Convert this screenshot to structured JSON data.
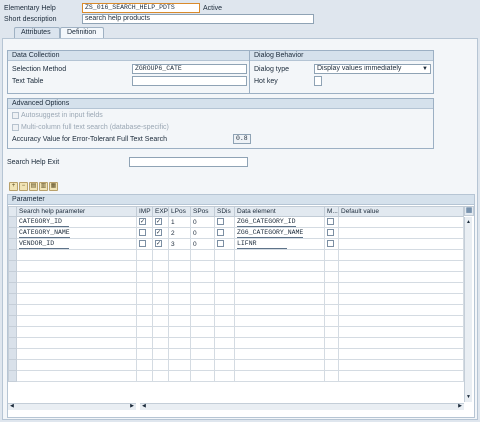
{
  "header": {
    "elementary_help_label": "Elementary Help",
    "elementary_help_value": "ZS_016_SEARCH_HELP_PDTS",
    "status": "Active",
    "short_description_label": "Short description",
    "short_description_value": "search help products"
  },
  "tabs": [
    {
      "label": "Attributes",
      "active": false
    },
    {
      "label": "Definition",
      "active": true
    }
  ],
  "data_collection": {
    "title": "Data Collection",
    "selection_method_label": "Selection Method",
    "selection_method_value": "ZGROUP6_CATE",
    "text_table_label": "Text Table",
    "text_table_value": ""
  },
  "dialog_behavior": {
    "title": "Dialog Behavior",
    "dialog_type_label": "Dialog type",
    "dialog_type_value": "Display values immediately",
    "hot_key_label": "Hot key",
    "hot_key_value": ""
  },
  "advanced_options": {
    "title": "Advanced Options",
    "autosuggest_label": "Autosuggest in input fields",
    "multicolumn_label": "Multi-column full text search (database-specific)",
    "accuracy_label": "Accuracy Value for Error-Tolerant Full Text Search",
    "accuracy_value": "0.8"
  },
  "search_help_exit": {
    "label": "Search Help Exit",
    "value": ""
  },
  "parameter_table": {
    "title": "Parameter",
    "columns": [
      "Search help parameter",
      "IMP",
      "EXP",
      "LPos",
      "SPos",
      "SDis",
      "Data element",
      "M...",
      "Default value"
    ],
    "rows": [
      {
        "param": "CATEGORY_ID",
        "imp": true,
        "exp": true,
        "lpos": "1",
        "spos": "0",
        "sdis": false,
        "data_element": "ZG6_CATEGORY_ID"
      },
      {
        "param": "CATEGORY_NAME",
        "imp": false,
        "exp": true,
        "lpos": "2",
        "spos": "0",
        "sdis": false,
        "data_element": "ZG6_CATEGORY_NAME"
      },
      {
        "param": "VENDOR_ID",
        "imp": false,
        "exp": true,
        "lpos": "3",
        "spos": "0",
        "sdis": false,
        "data_element": "LIFNR"
      }
    ],
    "empty_rows": 12
  },
  "icons": {
    "toolbar": [
      "insert-row-icon",
      "delete-row-icon",
      "copy-row-icon",
      "paste-row-icon",
      "details-icon"
    ],
    "table_settings": "table-settings-icon",
    "dropdown": "chevron-down-icon"
  },
  "colors": {
    "background": "#dfe6ee",
    "panel": "#f3f6f9",
    "group_title": "#d5e1ec",
    "focus_border": "#d98a2b"
  }
}
